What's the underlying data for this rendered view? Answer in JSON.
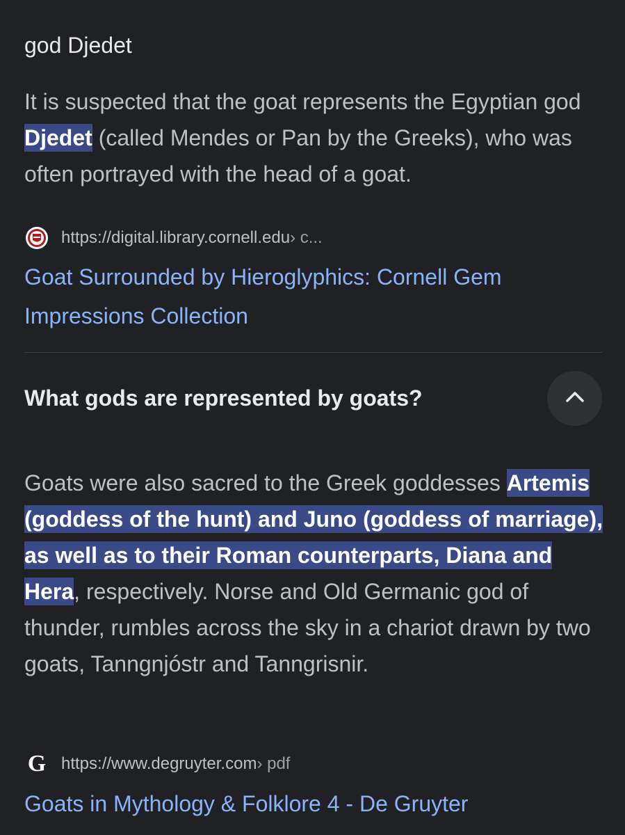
{
  "top_title": "god Djedet",
  "result1": {
    "snippet_before": "It is suspected that the goat represents the Egyptian god ",
    "snippet_highlight": "Djedet",
    "snippet_after": " (called Mendes or Pan by the Greeks), who was often portrayed with the head of a goat.",
    "source_url": "https://digital.library.cornell.edu",
    "source_path": " › c...",
    "favicon": "cornell-seal-icon",
    "link_title": "Goat Surrounded by Hieroglyphics: Cornell Gem Impressions Collection"
  },
  "question": {
    "text": "What gods are represented by goats?",
    "toggle_icon": "chevron-up-icon"
  },
  "result2": {
    "snippet_before": "Goats were also sacred to the Greek goddesses ",
    "snippet_highlight": "Artemis (goddess of the hunt) and Juno (goddess of marriage), as well as to their Roman counterparts, Diana and Hera",
    "snippet_after": ", respectively. Norse and Old Germanic god of thunder, rumbles across the sky in a chariot drawn by two goats, Tanngnjóstr and Tanngrisnir.",
    "source_url": "https://www.degruyter.com",
    "source_path": " › pdf",
    "favicon": "degruyter-g-icon",
    "favicon_letter": "G",
    "link_title": "Goats in Mythology & Folklore 4 - De Gruyter"
  },
  "colors": {
    "background": "#202124",
    "link": "#8ab4f8",
    "highlight": "#394a86",
    "text": "#bdc1c6"
  }
}
